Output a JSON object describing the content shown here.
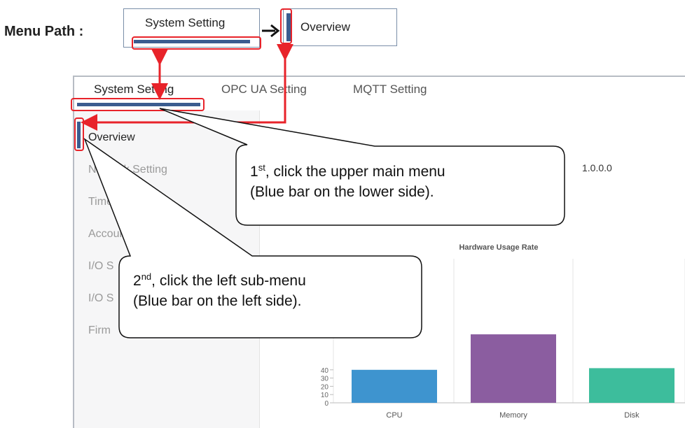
{
  "menu_path": {
    "label": "Menu Path :",
    "system_setting": "System Setting",
    "overview": "Overview"
  },
  "top_nav": {
    "tabs": [
      {
        "label": "System Setting"
      },
      {
        "label": "OPC UA Setting"
      },
      {
        "label": "MQTT Setting"
      }
    ]
  },
  "sidebar": {
    "items": [
      {
        "label": "Overview"
      },
      {
        "label": "Network Setting"
      },
      {
        "label": "Time S"
      },
      {
        "label": "Account S"
      },
      {
        "label": "I/O S"
      },
      {
        "label": "I/O S"
      },
      {
        "label": "Firm"
      }
    ]
  },
  "content": {
    "version_value": "1.0.0.0"
  },
  "callouts": {
    "first": {
      "ordinal": "1",
      "suffix": "st",
      "line1": ", click the upper main menu",
      "line2": "(Blue bar on the lower side)."
    },
    "second": {
      "ordinal": "2",
      "suffix": "nd",
      "line1": ", click the left sub-menu",
      "line2": "(Blue bar on the left side)."
    }
  },
  "colors": {
    "blue_bar": "#3b5c8f",
    "highlight_red": "#e8232a",
    "cpu": "#3e94cf",
    "memory": "#8b5da0",
    "disk": "#3dbd9c"
  },
  "chart_data": {
    "type": "bar",
    "title": "Hardware Usage Rate",
    "categories": [
      "CPU",
      "Memory",
      "Disk"
    ],
    "values": [
      40,
      83,
      42
    ],
    "ytick_labels": [
      "0",
      "10",
      "20",
      "30",
      "40"
    ],
    "ylim": [
      0,
      100
    ],
    "colors": [
      "#3e94cf",
      "#8b5da0",
      "#3dbd9c"
    ]
  }
}
